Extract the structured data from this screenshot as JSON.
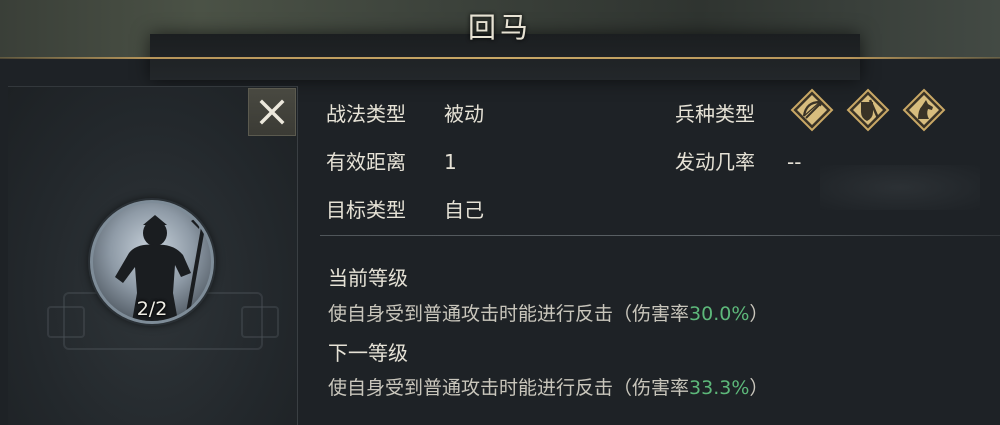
{
  "window": {
    "title": "回马"
  },
  "close_button": {
    "label": "✕"
  },
  "skill": {
    "level": "2/2"
  },
  "info": {
    "tactic_type": {
      "label": "战法类型",
      "value": "被动"
    },
    "range": {
      "label": "有效距离",
      "value": "1"
    },
    "target_type": {
      "label": "目标类型",
      "value": "自己"
    },
    "troop_type": {
      "label": "兵种类型",
      "icons": [
        "archer-icon",
        "shield-infantry-icon",
        "cavalry-icon"
      ]
    },
    "trigger_rate": {
      "label": "发动几率",
      "value": "--"
    }
  },
  "current_level": {
    "title": "当前等级",
    "desc_prefix": "使自身受到普通攻击时能进行反击（伤害率",
    "desc_value": "30.0%",
    "desc_suffix": "）"
  },
  "next_level": {
    "title": "下一等级",
    "desc_prefix": "使自身受到普通攻击时能进行反击（伤害率",
    "desc_value": "33.3%",
    "desc_suffix": "）"
  },
  "colors": {
    "accent_gold": "#c8a866",
    "highlight_green": "#5db87a",
    "panel_bg": "#1e2226"
  }
}
